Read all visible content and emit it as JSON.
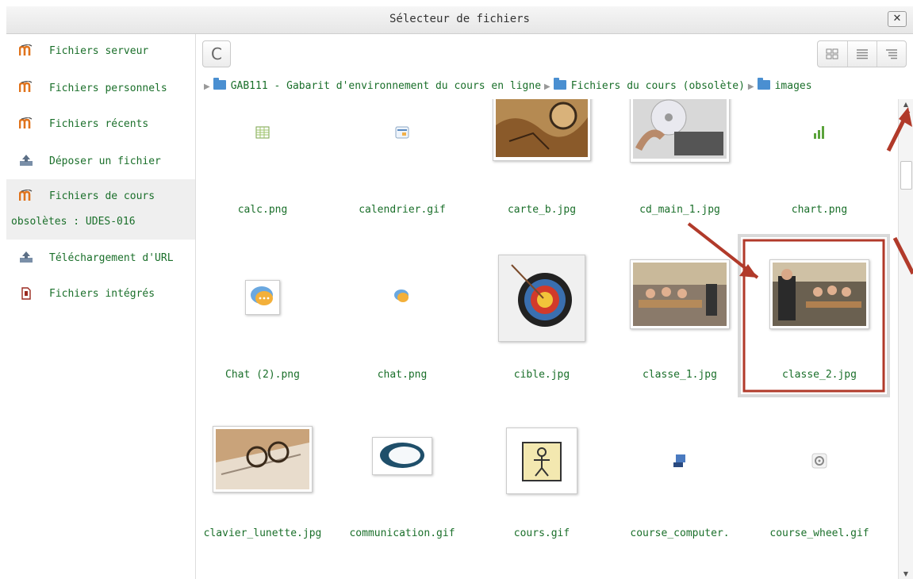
{
  "dialog": {
    "title": "Sélecteur de fichiers",
    "close_label": "✕"
  },
  "sidebar": {
    "items": [
      {
        "label": "Fichiers serveur",
        "icon": "moodle-icon"
      },
      {
        "label": "Fichiers personnels",
        "icon": "moodle-icon"
      },
      {
        "label": "Fichiers récents",
        "icon": "moodle-icon"
      },
      {
        "label": "Déposer un fichier",
        "icon": "upload-icon"
      },
      {
        "label": "Fichiers de cours",
        "label2": "obsolètes : UDES-016",
        "icon": "moodle-icon",
        "active": true
      },
      {
        "label": "Téléchargement d'URL",
        "icon": "upload-icon"
      },
      {
        "label": "Fichiers intégrés",
        "icon": "file-icon"
      }
    ]
  },
  "toolbar": {
    "refresh_label": "C",
    "views": [
      "view-icons-icon",
      "view-list-icon",
      "view-tree-icon"
    ]
  },
  "breadcrumb": {
    "parts": [
      "GAB111 - Gabarit d'environnement du cours en ligne",
      "Fichiers du cours (obsolète)",
      "images"
    ]
  },
  "files": [
    {
      "name": "calc.png",
      "thumb": "calc-icon"
    },
    {
      "name": "calendrier.gif",
      "thumb": "calendar-icon"
    },
    {
      "name": "carte_b.jpg",
      "thumb": "map-photo"
    },
    {
      "name": "cd_main_1.jpg",
      "thumb": "cd-photo"
    },
    {
      "name": "chart.png",
      "thumb": "chart-icon"
    },
    {
      "name": "Chat (2).png",
      "thumb": "chat-bubble-icon"
    },
    {
      "name": "chat.png",
      "thumb": "chat-bubble-icon"
    },
    {
      "name": "cible.jpg",
      "thumb": "target-photo"
    },
    {
      "name": "classe_1.jpg",
      "thumb": "classroom-photo"
    },
    {
      "name": "classe_2.jpg",
      "thumb": "classroom-photo",
      "highlighted": true
    },
    {
      "name": "clavier_lunette.jpg",
      "thumb": "keyboard-photo"
    },
    {
      "name": "communication.gif",
      "thumb": "speech-icon"
    },
    {
      "name": "cours.gif",
      "thumb": "course-drawing"
    },
    {
      "name": "course_computer.",
      "thumb": "computer-icon"
    },
    {
      "name": "course_wheel.gif",
      "thumb": "wheel-icon"
    }
  ],
  "colors": {
    "link": "#1a6f2a",
    "annotation": "#b13a2a",
    "folder": "#4a8fd1"
  }
}
